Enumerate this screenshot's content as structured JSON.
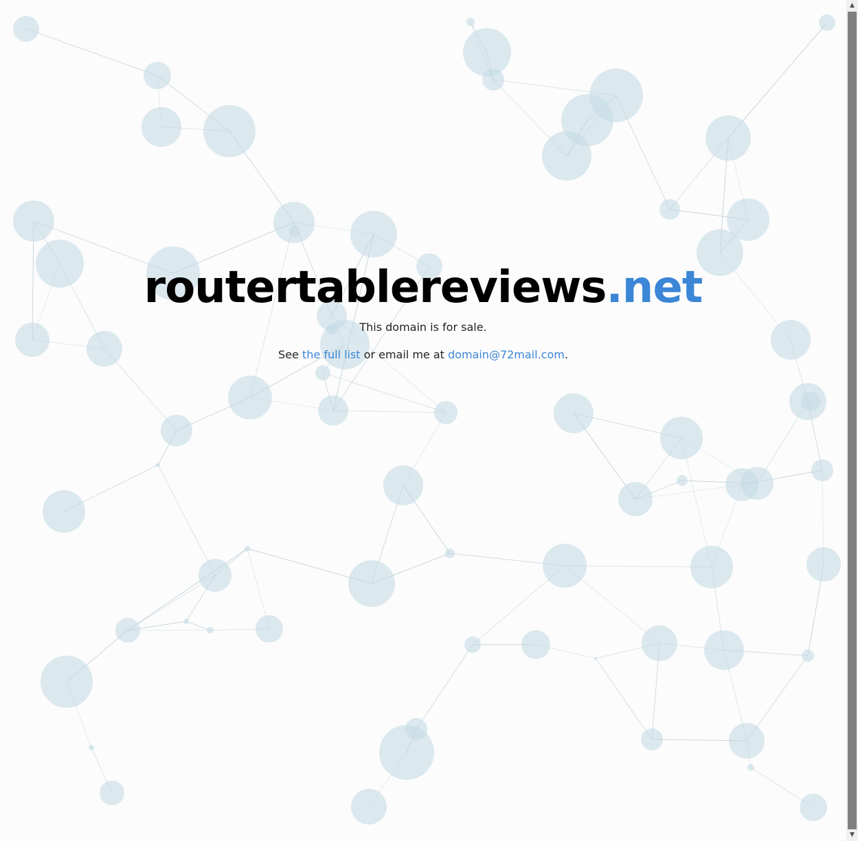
{
  "domain": {
    "name": "routertablereviews",
    "tld": ".net"
  },
  "sale_text": "This domain is for sale.",
  "contact": {
    "prefix": "See ",
    "list_link": "the full list",
    "middle": " or email me at ",
    "email": "domain@72mail.com",
    "suffix": "."
  },
  "colors": {
    "accent": "#3b86d6",
    "node": "#c5dbe4",
    "edge": "#9fb7c4"
  }
}
